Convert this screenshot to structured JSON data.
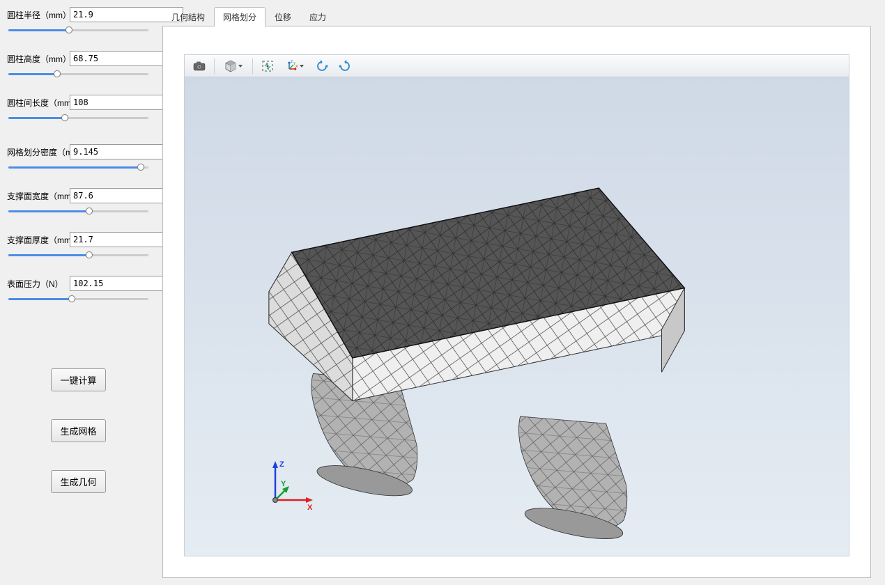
{
  "sidebar": {
    "params": [
      {
        "label": "圆柱半径（mm）",
        "value": "21.9",
        "pct": 43
      },
      {
        "label": "圆柱高度（mm）",
        "value": "68.75",
        "pct": 34
      },
      {
        "label": "圆柱间长度（mm）",
        "value": "108",
        "pct": 40
      },
      {
        "label": "网格划分密度（mm）",
        "value": "9.145",
        "pct": 97,
        "extra_gap": true
      },
      {
        "label": "支撑面宽度（mm）",
        "value": "87.6",
        "pct": 58
      },
      {
        "label": "支撑面厚度（mm）",
        "value": "21.7",
        "pct": 58
      },
      {
        "label": "表面压力（N）",
        "value": "102.15",
        "pct": 45
      }
    ],
    "buttons": {
      "compute": "一键计算",
      "mesh": "生成网格",
      "geometry": "生成几何"
    }
  },
  "tabs": [
    {
      "id": "geometry",
      "label": "几何结构",
      "active": false
    },
    {
      "id": "mesh",
      "label": "网格划分",
      "active": true
    },
    {
      "id": "displacement",
      "label": "位移",
      "active": false
    },
    {
      "id": "stress",
      "label": "应力",
      "active": false
    }
  ],
  "toolbar_icons": {
    "camera": "camera-icon",
    "cube": "cube-icon",
    "fit": "fit-view-icon",
    "axes": "axes-xyz-icon",
    "rotate_ccw": "rotate-ccw-icon",
    "rotate_cw": "rotate-cw-icon"
  },
  "triad": {
    "x": "X",
    "y": "Y",
    "z": "Z"
  }
}
